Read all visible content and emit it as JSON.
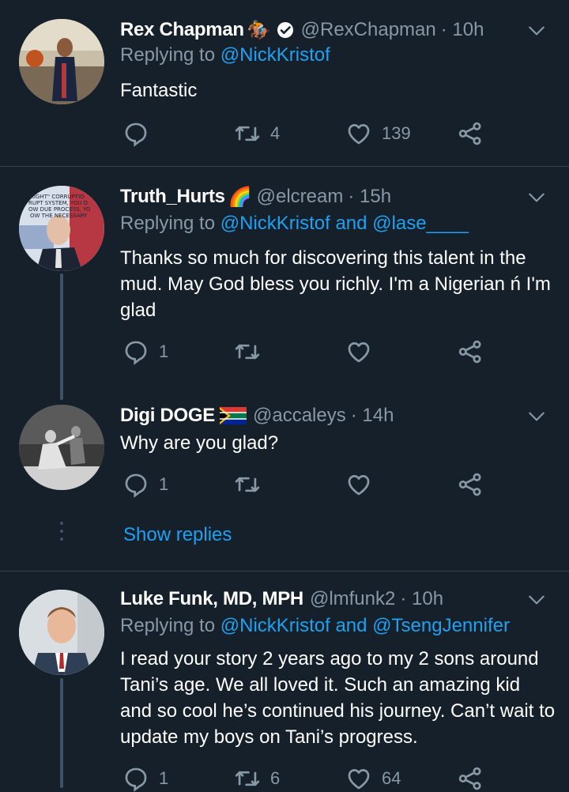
{
  "tweets": [
    {
      "name": "Rex Chapman",
      "name_emoji": "🏇",
      "handle": "@RexChapman",
      "time": "· 10h",
      "reply_prefix": "Replying to",
      "reply_to": "@NickKristof",
      "text": "Fantastic",
      "replies": "",
      "retweets": "4",
      "likes": "139"
    },
    {
      "name": "Truth_Hurts",
      "name_emoji": "🌈",
      "handle": "@elcream",
      "time": "· 15h",
      "reply_prefix": "Replying to",
      "reply_to": "@NickKristof and @lase____",
      "text": "Thanks so much for discovering this talent in the mud. May God bless you richly. I'm a Nigerian ń I'm glad",
      "replies": "1",
      "retweets": "",
      "likes": "",
      "avatar_text": "\"RIGHT\" CORRUPTION CORRUPT SYSTEM, YOU DON'T FOLLOW DUE PROCESS, YOU FOLLOW THE NECESSARY PROCESS - PUTIN"
    },
    {
      "name": "Digi DOGE",
      "handle": "@accaleys",
      "time": "· 14h",
      "text": "Why are you glad?",
      "replies": "1",
      "retweets": "",
      "likes": ""
    },
    {
      "name": "Luke Funk, MD, MPH",
      "handle": "@lmfunk2",
      "time": "· 10h",
      "reply_prefix": "Replying to",
      "reply_to": "@NickKristof and @TsengJennifer",
      "text": "I read your story 2 years ago to my 2 sons around Tani’s age. We all loved it. Such an amazing kid and so cool he’s continued his journey. Can’t wait to update my boys on Tani’s progress.",
      "replies": "1",
      "retweets": "6",
      "likes": "64"
    }
  ],
  "show_replies": "Show replies",
  "colors": {
    "background": "#15202b",
    "secondary_text": "#8899a6",
    "link": "#1da1f2",
    "divider": "#38444d"
  }
}
